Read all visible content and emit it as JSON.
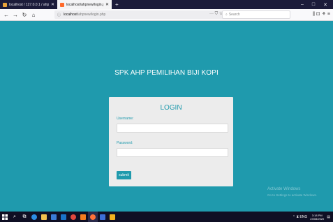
{
  "browser": {
    "tabs": [
      {
        "label": "localhost / 127.0.0.1 / ahpcko",
        "favicon_color": "#e8a33a",
        "close": "✕"
      },
      {
        "label": "localhost/ahpnew/login.php",
        "favicon_color": "#ff6a2b",
        "close": "✕"
      }
    ],
    "new_tab": "+",
    "window_controls": {
      "minimize": "–",
      "maximize": "□",
      "close": "✕"
    },
    "nav": {
      "back": "←",
      "forward": "→",
      "reload": "↻",
      "home": "⌂"
    },
    "url": {
      "host": "localhost",
      "path": "/ahpnew/login.php"
    },
    "url_actions": "··· ⛉ ☆",
    "search_placeholder": "Search",
    "toolbar_icons": "⫼ ⊡ ⚘ ≡"
  },
  "page": {
    "heading": "SPK AHP PEMILIHAN BIJI KOPI",
    "login": {
      "title": "LOGIN",
      "username_label": "Username:",
      "username_value": "",
      "password_label": "Password:",
      "password_value": "",
      "submit_label": "submit"
    }
  },
  "watermark": {
    "title": "Activate Windows",
    "subtitle": "Go to Settings to activate Windows."
  },
  "taskbar": {
    "tray": "⌃ ⧗ ENG",
    "time": "3:18 PM",
    "date": "23/08/2020"
  },
  "colors": {
    "page_bg": "#1f9aad",
    "card_bg": "#ececec",
    "accent": "#1f9aad",
    "taskbar": "#0f0f24"
  }
}
